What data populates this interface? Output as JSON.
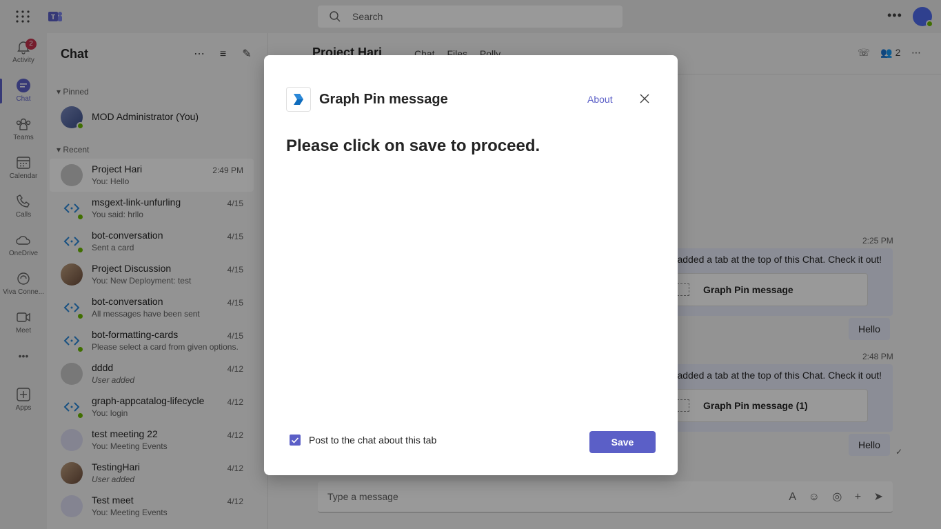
{
  "search": {
    "placeholder": "Search"
  },
  "rail": {
    "items": [
      {
        "label": "Activity",
        "icon": "bell-icon",
        "badge": "2"
      },
      {
        "label": "Chat",
        "icon": "chat-icon"
      },
      {
        "label": "Teams",
        "icon": "teams-icon"
      },
      {
        "label": "Calendar",
        "icon": "calendar-icon"
      },
      {
        "label": "Calls",
        "icon": "phone-icon"
      },
      {
        "label": "OneDrive",
        "icon": "cloud-icon"
      },
      {
        "label": "Viva Conne...",
        "icon": "viva-icon"
      },
      {
        "label": "Meet",
        "icon": "video-icon"
      },
      {
        "label": "Apps",
        "icon": "apps-add-icon"
      }
    ],
    "more": "•••"
  },
  "chatpane": {
    "title": "Chat",
    "pinned_label": "Pinned",
    "recent_label": "Recent",
    "pinned": [
      {
        "name": "MOD Administrator (You)"
      }
    ],
    "recent": [
      {
        "name": "Project Hari",
        "preview": "You: Hello",
        "time": "2:49 PM"
      },
      {
        "name": "msgext-link-unfurling",
        "preview": "You said: hrllo",
        "time": "4/15"
      },
      {
        "name": "bot-conversation",
        "preview": "Sent a card",
        "time": "4/15"
      },
      {
        "name": "Project Discussion",
        "preview": "You: New Deployment: test",
        "time": "4/15"
      },
      {
        "name": "bot-conversation",
        "preview": "All messages have been sent",
        "time": "4/15"
      },
      {
        "name": "bot-formatting-cards",
        "preview": "Please select a card from given options.",
        "time": "4/15"
      },
      {
        "name": "dddd",
        "preview": "User added",
        "time": "4/12"
      },
      {
        "name": "graph-appcatalog-lifecycle",
        "preview": "You: login",
        "time": "4/12"
      },
      {
        "name": "test meeting 22",
        "preview": "You: Meeting Events",
        "time": "4/12"
      },
      {
        "name": "TestingHari",
        "preview": "User added",
        "time": "4/12"
      },
      {
        "name": "Test meet",
        "preview": "You: Meeting Events",
        "time": "4/12"
      }
    ]
  },
  "main": {
    "title": "Project Hari",
    "tabs": [
      "Chat",
      "Files",
      "Polly"
    ],
    "participants": "2",
    "messages": [
      {
        "time": "2:25 PM",
        "text": "added a tab at the top of this Chat. Check it out!",
        "card": "Graph Pin message"
      },
      {
        "time": "2:48 PM",
        "text": "added a tab at the top of this Chat. Check it out!",
        "card": "Graph Pin message (1)"
      }
    ],
    "hello": "Hello",
    "composer_placeholder": "Type a message"
  },
  "dialog": {
    "title": "Graph Pin message",
    "about": "About",
    "body": "Please click on save to proceed.",
    "checkbox_label": "Post to the chat about this tab",
    "checkbox_checked": true,
    "save": "Save"
  },
  "colors": {
    "accent": "#5b5fc7",
    "badge": "#c4314b",
    "presence": "#6bb700"
  }
}
